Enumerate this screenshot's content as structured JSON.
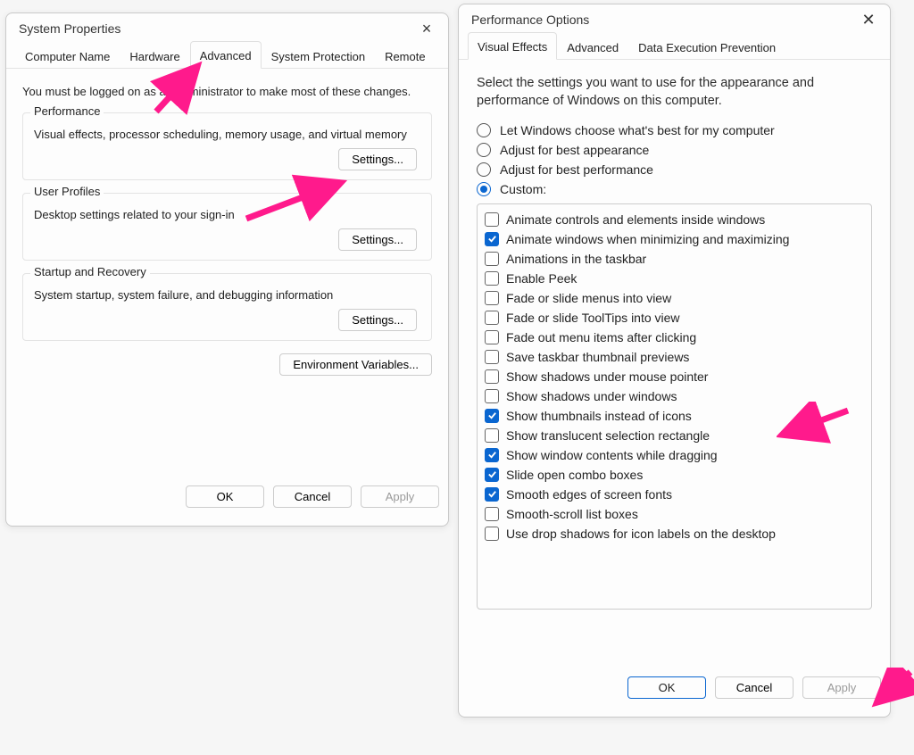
{
  "system_properties": {
    "title": "System Properties",
    "tabs": [
      "Computer Name",
      "Hardware",
      "Advanced",
      "System Protection",
      "Remote"
    ],
    "active_tab": 2,
    "intro": "You must be logged on as an Administrator to make most of these changes.",
    "groups": {
      "performance": {
        "title": "Performance",
        "desc": "Visual effects, processor scheduling, memory usage, and virtual memory",
        "button": "Settings..."
      },
      "user_profiles": {
        "title": "User Profiles",
        "desc": "Desktop settings related to your sign-in",
        "button": "Settings..."
      },
      "startup": {
        "title": "Startup and Recovery",
        "desc": "System startup, system failure, and debugging information",
        "button": "Settings..."
      }
    },
    "env_button": "Environment Variables...",
    "buttons": {
      "ok": "OK",
      "cancel": "Cancel",
      "apply": "Apply"
    }
  },
  "performance_options": {
    "title": "Performance Options",
    "tabs": [
      "Visual Effects",
      "Advanced",
      "Data Execution Prevention"
    ],
    "active_tab": 0,
    "intro": "Select the settings you want to use for the appearance and performance of Windows on this computer.",
    "radios": [
      {
        "label": "Let Windows choose what's best for my computer",
        "checked": false
      },
      {
        "label": "Adjust for best appearance",
        "checked": false
      },
      {
        "label": "Adjust for best performance",
        "checked": false
      },
      {
        "label": "Custom:",
        "checked": true
      }
    ],
    "options": [
      {
        "label": "Animate controls and elements inside windows",
        "checked": false
      },
      {
        "label": "Animate windows when minimizing and maximizing",
        "checked": true
      },
      {
        "label": "Animations in the taskbar",
        "checked": false
      },
      {
        "label": "Enable Peek",
        "checked": false
      },
      {
        "label": "Fade or slide menus into view",
        "checked": false
      },
      {
        "label": "Fade or slide ToolTips into view",
        "checked": false
      },
      {
        "label": "Fade out menu items after clicking",
        "checked": false
      },
      {
        "label": "Save taskbar thumbnail previews",
        "checked": false
      },
      {
        "label": "Show shadows under mouse pointer",
        "checked": false
      },
      {
        "label": "Show shadows under windows",
        "checked": false
      },
      {
        "label": "Show thumbnails instead of icons",
        "checked": true
      },
      {
        "label": "Show translucent selection rectangle",
        "checked": false
      },
      {
        "label": "Show window contents while dragging",
        "checked": true
      },
      {
        "label": "Slide open combo boxes",
        "checked": true
      },
      {
        "label": "Smooth edges of screen fonts",
        "checked": true
      },
      {
        "label": "Smooth-scroll list boxes",
        "checked": false
      },
      {
        "label": "Use drop shadows for icon labels on the desktop",
        "checked": false
      }
    ],
    "buttons": {
      "ok": "OK",
      "cancel": "Cancel",
      "apply": "Apply"
    }
  }
}
